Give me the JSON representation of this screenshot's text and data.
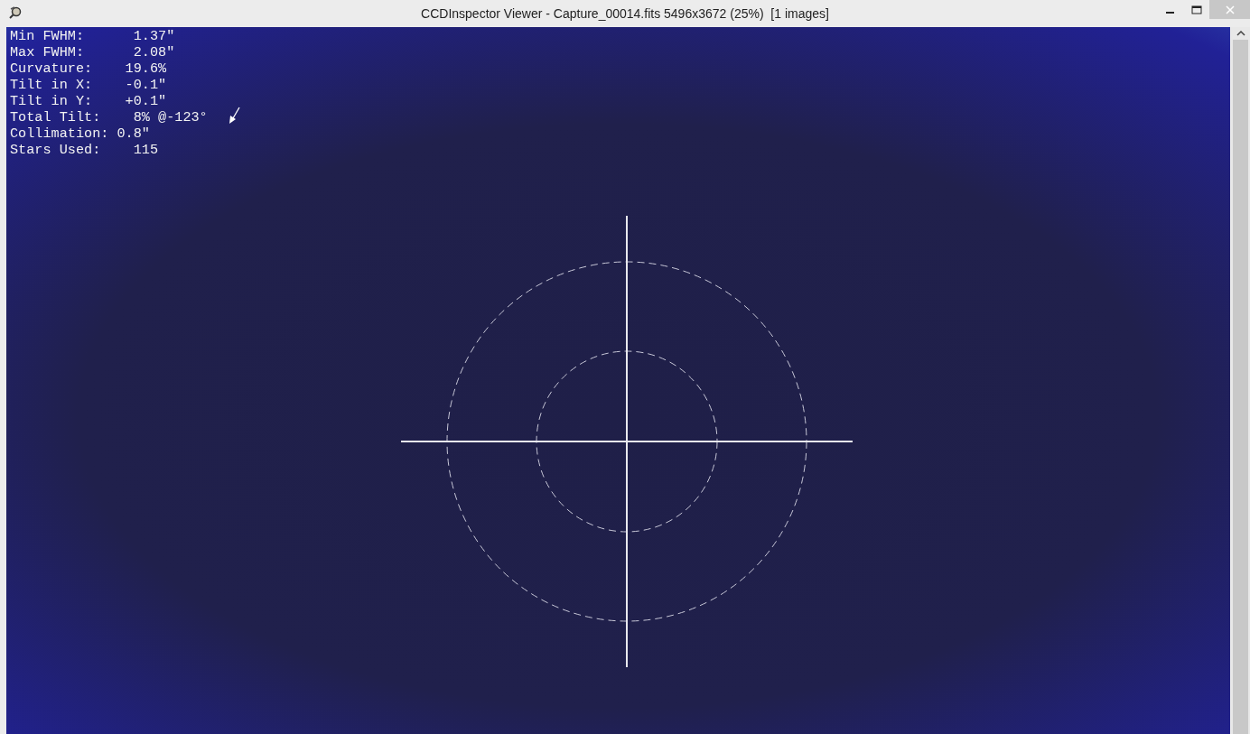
{
  "window": {
    "title": "CCDInspector Viewer - Capture_00014.fits 5496x3672 (25%)  [1 images]"
  },
  "stats": [
    {
      "line": "Min FWHM:      1.37\""
    },
    {
      "line": "Max FWHM:      2.08\""
    },
    {
      "line": "Curvature:    19.6%"
    },
    {
      "line": "Tilt in X:    -0.1\""
    },
    {
      "line": "Tilt in Y:    +0.1\""
    },
    {
      "line": "Total Tilt:    8% @-123°"
    },
    {
      "line": "Collimation: 0.8\""
    },
    {
      "line": "Stars Used:    115"
    }
  ]
}
